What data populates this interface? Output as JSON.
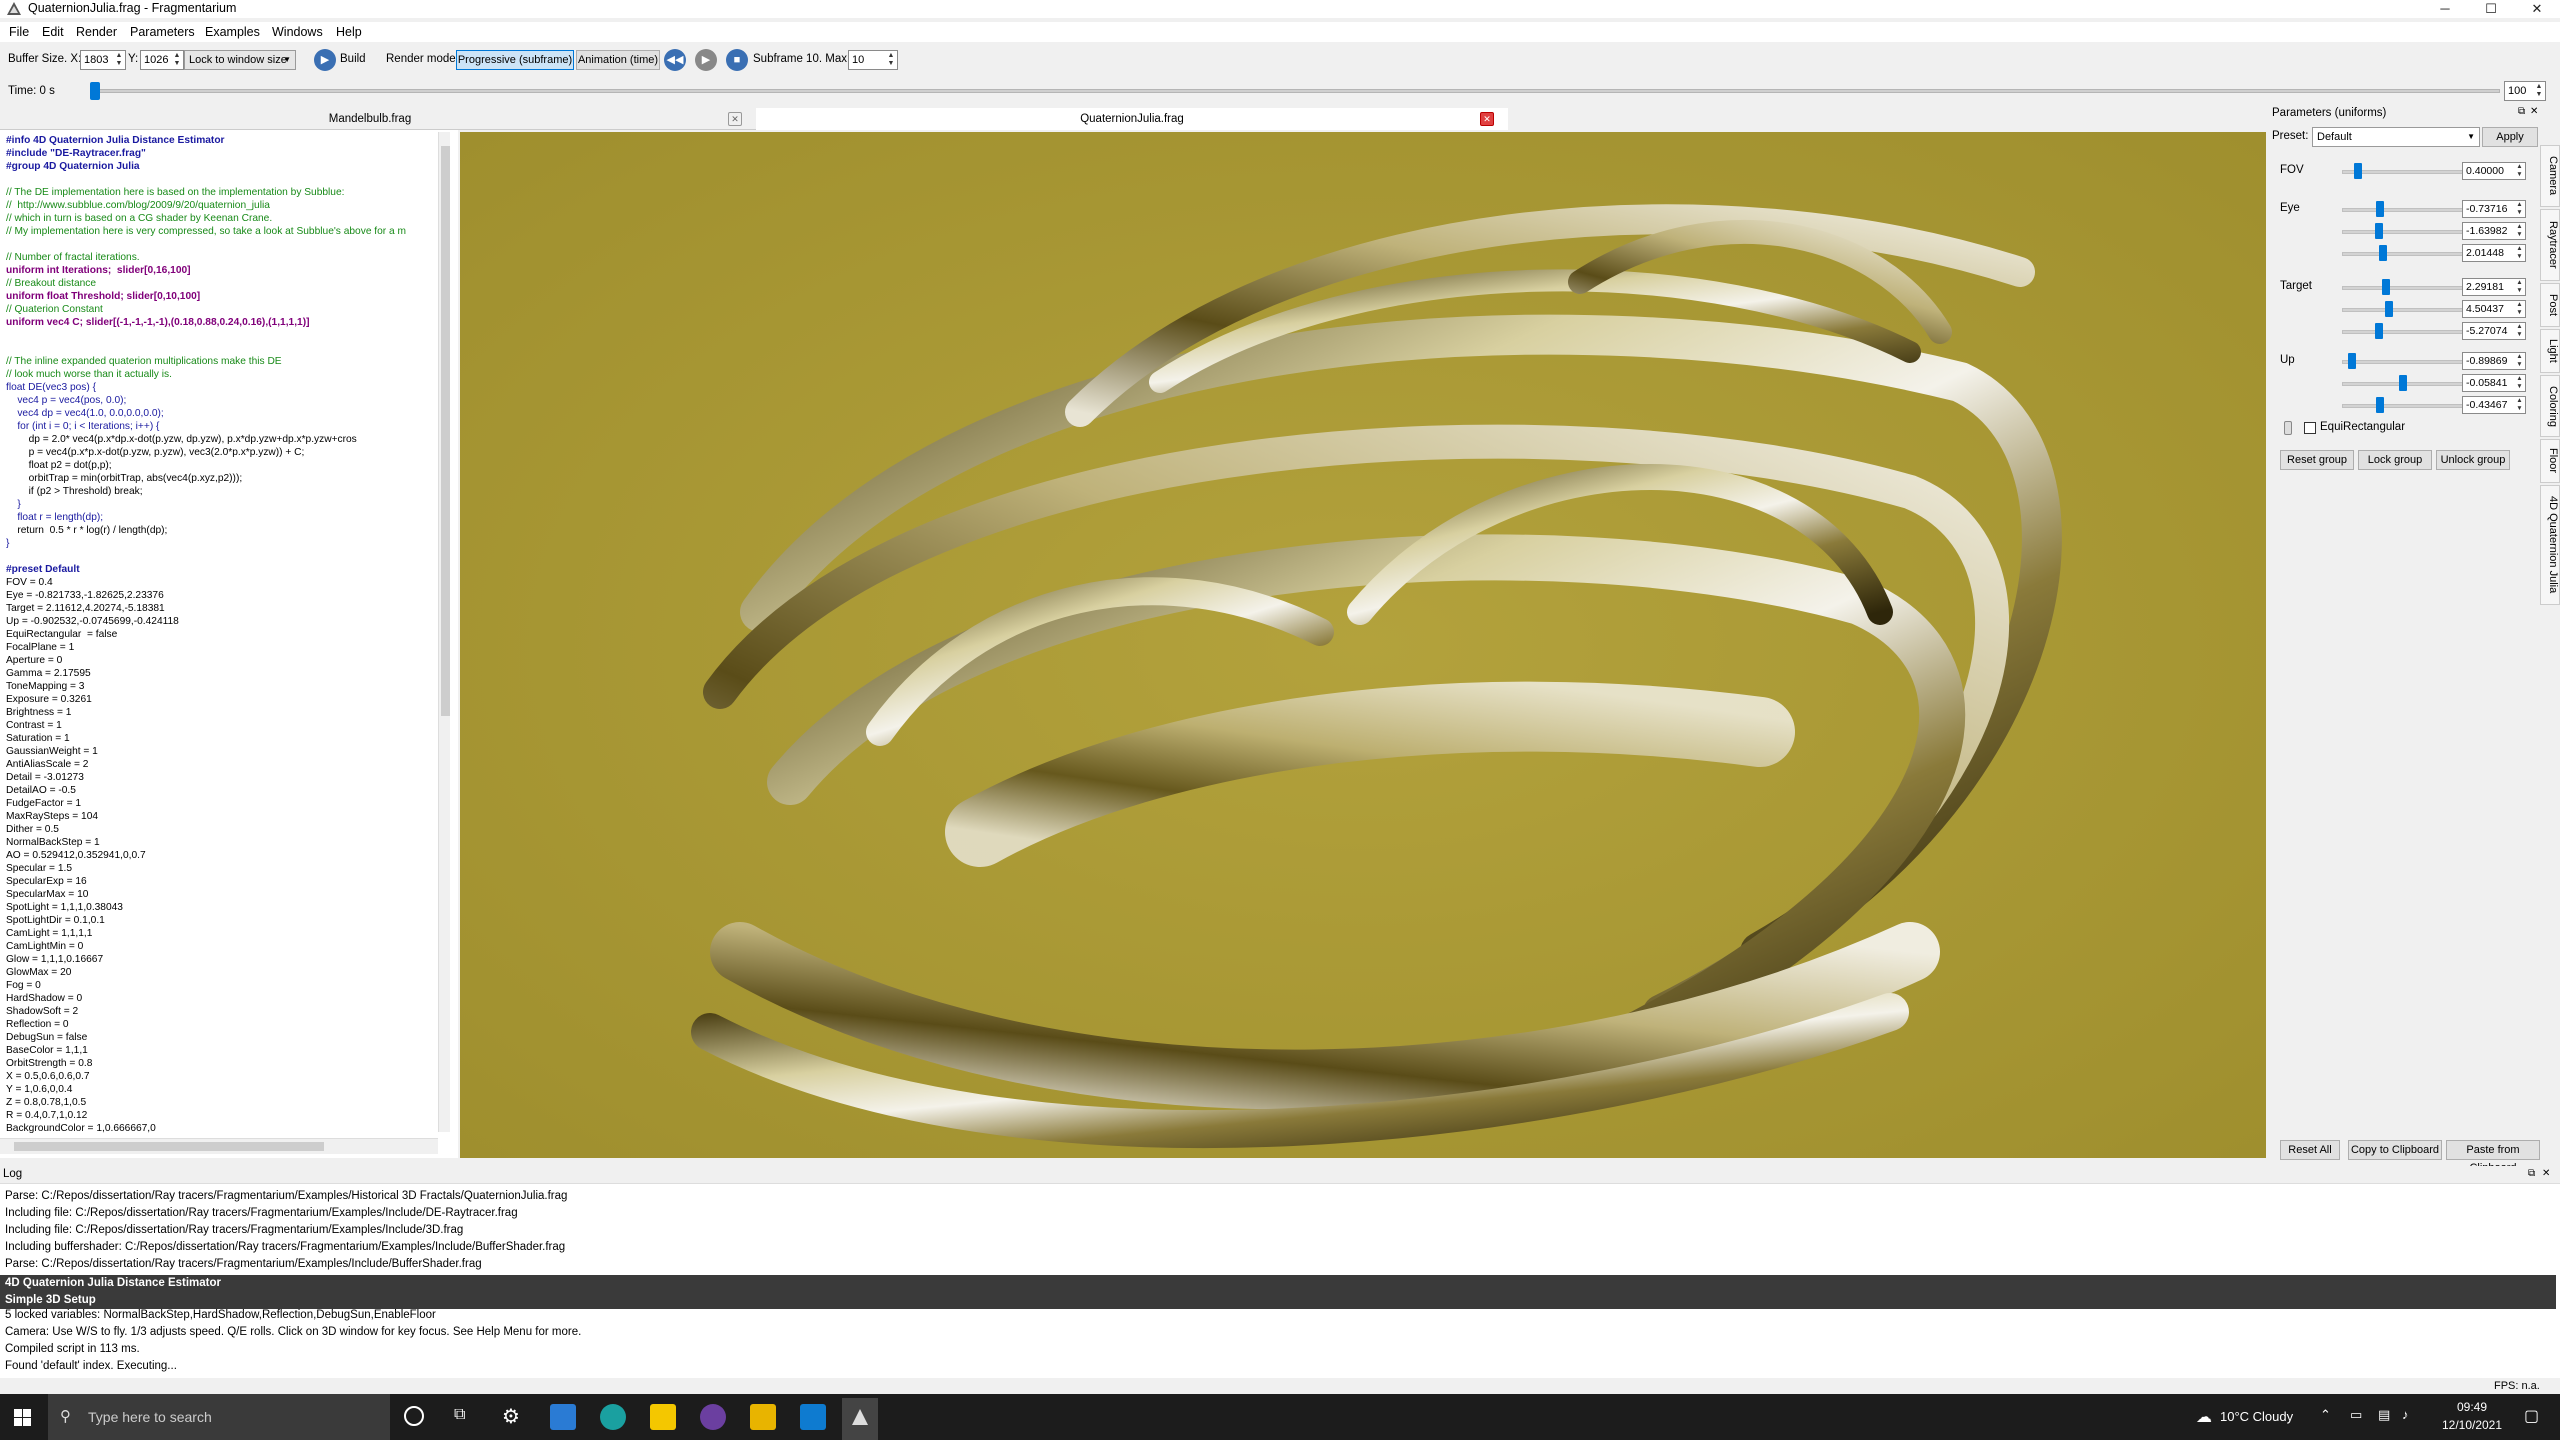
{
  "window": {
    "title": "QuaternionJulia.frag - Fragmentarium",
    "min": "─",
    "max": "☐",
    "close": "✕"
  },
  "menu": [
    "File",
    "Edit",
    "Render",
    "Parameters",
    "Examples",
    "Windows",
    "Help"
  ],
  "toolbar": {
    "buffer_label": "Buffer Size. X:",
    "buffer_x": "1803",
    "y_label": "Y:",
    "buffer_y": "1026",
    "lock_combo": "Lock to window size",
    "build_label": "Build",
    "render_mode_label": "Render mode:",
    "progressive_label": "Progressive (subframe)",
    "animation_label": "Animation (time)",
    "subframe_label": "Subframe 10. Max:",
    "subframe_max": "10"
  },
  "timebar": {
    "label": "Time: 0 s",
    "value": "100"
  },
  "editor": {
    "tabs": [
      {
        "label": "Mandelbulb.frag"
      },
      {
        "label": "QuaternionJulia.frag"
      }
    ],
    "lines": [
      {
        "t": "#info 4D Quaternion Julia Distance Estimator",
        "c": "pp"
      },
      {
        "t": "#include \"DE-Raytracer.frag\"",
        "c": "pp"
      },
      {
        "t": "#group 4D Quaternion Julia",
        "c": "pp"
      },
      {
        "t": "",
        "c": "tx"
      },
      {
        "t": "// The DE implementation here is based on the implementation by Subblue:",
        "c": "cm"
      },
      {
        "t": "//  http://www.subblue.com/blog/2009/9/20/quaternion_julia",
        "c": "cm"
      },
      {
        "t": "// which in turn is based on a CG shader by Keenan Crane.",
        "c": "cm"
      },
      {
        "t": "// My implementation here is very compressed, so take a look at Subblue's above for a m",
        "c": "cm"
      },
      {
        "t": "",
        "c": "tx"
      },
      {
        "t": "// Number of fractal iterations.",
        "c": "cm"
      },
      {
        "t": "uniform int Iterations;  slider[0,16,100]",
        "c": "kw"
      },
      {
        "t": "// Breakout distance",
        "c": "cm"
      },
      {
        "t": "uniform float Threshold; slider[0,10,100]",
        "c": "kw"
      },
      {
        "t": "// Quaterion Constant",
        "c": "cm"
      },
      {
        "t": "uniform vec4 C; slider[(-1,-1,-1,-1),(0.18,0.88,0.24,0.16),(1,1,1,1)]",
        "c": "kw"
      },
      {
        "t": "",
        "c": "tx"
      },
      {
        "t": "",
        "c": "tx"
      },
      {
        "t": "// The inline expanded quaterion multiplications make this DE",
        "c": "cm"
      },
      {
        "t": "// look much worse than it actually is.",
        "c": "cm"
      },
      {
        "t": "float DE(vec3 pos) {",
        "c": "bl"
      },
      {
        "t": "    vec4 p = vec4(pos, 0.0);",
        "c": "bl"
      },
      {
        "t": "    vec4 dp = vec4(1.0, 0.0,0.0,0.0);",
        "c": "bl"
      },
      {
        "t": "    for (int i = 0; i < Iterations; i++) {",
        "c": "bl"
      },
      {
        "t": "        dp = 2.0* vec4(p.x*dp.x-dot(p.yzw, dp.yzw), p.x*dp.yzw+dp.x*p.yzw+cros",
        "c": "tx"
      },
      {
        "t": "        p = vec4(p.x*p.x-dot(p.yzw, p.yzw), vec3(2.0*p.x*p.yzw)) + C;",
        "c": "tx"
      },
      {
        "t": "        float p2 = dot(p,p);",
        "c": "tx"
      },
      {
        "t": "        orbitTrap = min(orbitTrap, abs(vec4(p.xyz,p2)));",
        "c": "tx"
      },
      {
        "t": "        if (p2 > Threshold) break;",
        "c": "tx"
      },
      {
        "t": "    }",
        "c": "bl"
      },
      {
        "t": "    float r = length(dp);",
        "c": "bl"
      },
      {
        "t": "    return  0.5 * r * log(r) / length(dp);",
        "c": "tx"
      },
      {
        "t": "}",
        "c": "bl"
      },
      {
        "t": "",
        "c": "tx"
      },
      {
        "t": "#preset Default",
        "c": "pp"
      },
      {
        "t": "FOV = 0.4",
        "c": "tx"
      },
      {
        "t": "Eye = -0.821733,-1.82625,2.23376",
        "c": "tx"
      },
      {
        "t": "Target = 2.11612,4.20274,-5.18381",
        "c": "tx"
      },
      {
        "t": "Up = -0.902532,-0.0745699,-0.424118",
        "c": "tx"
      },
      {
        "t": "EquiRectangular  = false",
        "c": "tx"
      },
      {
        "t": "FocalPlane = 1",
        "c": "tx"
      },
      {
        "t": "Aperture = 0",
        "c": "tx"
      },
      {
        "t": "Gamma = 2.17595",
        "c": "tx"
      },
      {
        "t": "ToneMapping = 3",
        "c": "tx"
      },
      {
        "t": "Exposure = 0.3261",
        "c": "tx"
      },
      {
        "t": "Brightness = 1",
        "c": "tx"
      },
      {
        "t": "Contrast = 1",
        "c": "tx"
      },
      {
        "t": "Saturation = 1",
        "c": "tx"
      },
      {
        "t": "GaussianWeight = 1",
        "c": "tx"
      },
      {
        "t": "AntiAliasScale = 2",
        "c": "tx"
      },
      {
        "t": "Detail = -3.01273",
        "c": "tx"
      },
      {
        "t": "DetailAO = -0.5",
        "c": "tx"
      },
      {
        "t": "FudgeFactor = 1",
        "c": "tx"
      },
      {
        "t": "MaxRaySteps = 104",
        "c": "tx"
      },
      {
        "t": "Dither = 0.5",
        "c": "tx"
      },
      {
        "t": "NormalBackStep = 1",
        "c": "tx"
      },
      {
        "t": "AO = 0.529412,0.352941,0,0.7",
        "c": "tx"
      },
      {
        "t": "Specular = 1.5",
        "c": "tx"
      },
      {
        "t": "SpecularExp = 16",
        "c": "tx"
      },
      {
        "t": "SpecularMax = 10",
        "c": "tx"
      },
      {
        "t": "SpotLight = 1,1,1,0.38043",
        "c": "tx"
      },
      {
        "t": "SpotLightDir = 0.1,0.1",
        "c": "tx"
      },
      {
        "t": "CamLight = 1,1,1,1",
        "c": "tx"
      },
      {
        "t": "CamLightMin = 0",
        "c": "tx"
      },
      {
        "t": "Glow = 1,1,1,0.16667",
        "c": "tx"
      },
      {
        "t": "GlowMax = 20",
        "c": "tx"
      },
      {
        "t": "Fog = 0",
        "c": "tx"
      },
      {
        "t": "HardShadow = 0",
        "c": "tx"
      },
      {
        "t": "ShadowSoft = 2",
        "c": "tx"
      },
      {
        "t": "Reflection = 0",
        "c": "tx"
      },
      {
        "t": "DebugSun = false",
        "c": "tx"
      },
      {
        "t": "BaseColor = 1,1,1",
        "c": "tx"
      },
      {
        "t": "OrbitStrength = 0.8",
        "c": "tx"
      },
      {
        "t": "X = 0.5,0.6,0.6,0.7",
        "c": "tx"
      },
      {
        "t": "Y = 1,0.6,0,0.4",
        "c": "tx"
      },
      {
        "t": "Z = 0.8,0.78,1,0.5",
        "c": "tx"
      },
      {
        "t": "R = 0.4,0.7,1,0.12",
        "c": "tx"
      },
      {
        "t": "BackgroundColor = 1,0.666667,0",
        "c": "tx"
      }
    ]
  },
  "params": {
    "title": "Parameters (uniforms)",
    "preset_label": "Preset:",
    "preset_value": "Default",
    "apply_label": "Apply",
    "fov_label": "FOV",
    "fov_value": "0.40000",
    "fov_level": 0.1,
    "eye_label": "Eye",
    "eye_values": [
      "-0.73716",
      "-1.63982",
      "2.01448"
    ],
    "eye_levels": [
      0.28,
      0.27,
      0.3
    ],
    "target_label": "Target",
    "target_values": [
      "2.29181",
      "4.50437",
      "-5.27074"
    ],
    "target_levels": [
      0.33,
      0.35,
      0.27
    ],
    "up_label": "Up",
    "up_values": [
      "-0.89869",
      "-0.05841",
      "-0.43467"
    ],
    "up_levels": [
      0.05,
      0.47,
      0.28
    ],
    "equirect_label": "EquiRectangular",
    "reset_group": "Reset group",
    "lock_group": "Lock group",
    "unlock_group": "Unlock group",
    "reset_all": "Reset All",
    "copy_clip": "Copy to Clipboard",
    "paste_clip": "Paste from Clipboard",
    "side_tabs": [
      "Camera",
      "Raytracer",
      "Post",
      "Light",
      "Coloring",
      "Floor",
      "4D Quaternion Julia"
    ]
  },
  "log": {
    "title": "Log",
    "lines": [
      "Parse: C:/Repos/dissertation/Ray tracers/Fragmentarium/Examples/Historical 3D Fractals/QuaternionJulia.frag",
      "Including file: C:/Repos/dissertation/Ray tracers/Fragmentarium/Examples/Include/DE-Raytracer.frag",
      "Including file: C:/Repos/dissertation/Ray tracers/Fragmentarium/Examples/Include/3D.frag",
      "Including buffershader: C:/Repos/dissertation/Ray tracers/Fragmentarium/Examples/Include/BufferShader.frag",
      "Parse: C:/Repos/dissertation/Ray tracers/Fragmentarium/Examples/Include/BufferShader.frag"
    ],
    "sel_lines": [
      "4D Quaternion Julia Distance Estimator",
      "Simple 3D Setup"
    ],
    "tail_lines": [
      "5 locked variables: NormalBackStep,HardShadow,Reflection,DebugSun,EnableFloor",
      "Camera: Use W/S to fly. 1/3 adjusts speed. Q/E rolls. Click on 3D window for key focus. See Help Menu for more.",
      "Compiled script in 113 ms.",
      "Found 'default' index. Executing..."
    ]
  },
  "status": {
    "fps": "FPS: n.a."
  },
  "taskbar": {
    "search_placeholder": "Type here to search",
    "weather": "10°C  Cloudy",
    "time": "09:49",
    "date": "12/10/2021"
  }
}
